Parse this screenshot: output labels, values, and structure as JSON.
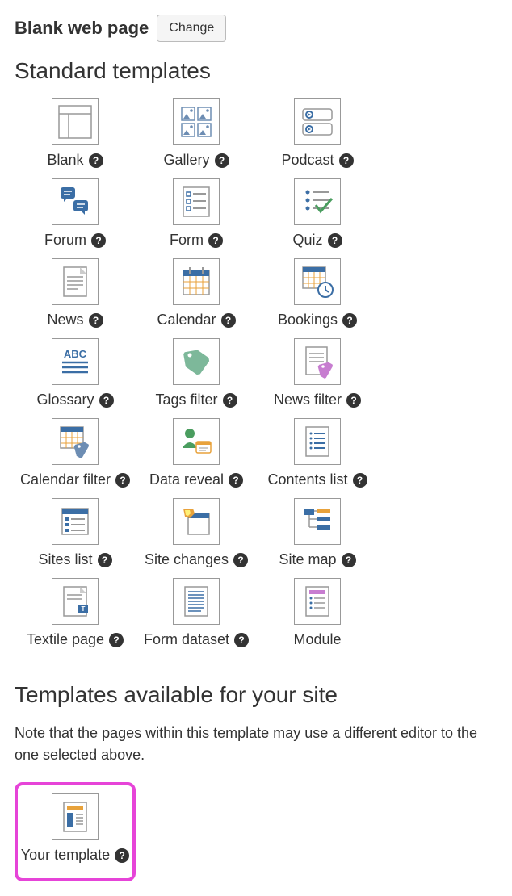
{
  "header": {
    "title": "Blank web page",
    "change_label": "Change"
  },
  "section1": {
    "heading": "Standard templates",
    "templates": [
      {
        "label": "Blank",
        "icon": "blank",
        "help": true
      },
      {
        "label": "Gallery",
        "icon": "gallery",
        "help": true
      },
      {
        "label": "Podcast",
        "icon": "podcast",
        "help": true
      },
      {
        "label": "Forum",
        "icon": "forum",
        "help": true
      },
      {
        "label": "Form",
        "icon": "form",
        "help": true
      },
      {
        "label": "Quiz",
        "icon": "quiz",
        "help": true
      },
      {
        "label": "News",
        "icon": "news",
        "help": true
      },
      {
        "label": "Calendar",
        "icon": "calendar",
        "help": true
      },
      {
        "label": "Bookings",
        "icon": "bookings",
        "help": true
      },
      {
        "label": "Glossary",
        "icon": "glossary",
        "help": true
      },
      {
        "label": "Tags filter",
        "icon": "tags",
        "help": true
      },
      {
        "label": "News filter",
        "icon": "newsfilter",
        "help": true
      },
      {
        "label": "Calendar filter",
        "icon": "calfilter",
        "help": true
      },
      {
        "label": "Data reveal",
        "icon": "datareveal",
        "help": true
      },
      {
        "label": "Contents list",
        "icon": "contents",
        "help": true
      },
      {
        "label": "Sites list",
        "icon": "siteslist",
        "help": true
      },
      {
        "label": "Site changes",
        "icon": "sitechanges",
        "help": true
      },
      {
        "label": "Site map",
        "icon": "sitemap",
        "help": true
      },
      {
        "label": "Textile page",
        "icon": "textile",
        "help": true
      },
      {
        "label": "Form dataset",
        "icon": "formdataset",
        "help": true
      },
      {
        "label": "Module",
        "icon": "module",
        "help": false
      }
    ]
  },
  "section2": {
    "heading": "Templates available for your site",
    "note": "Note that the pages within this template may use a different editor to the one selected above.",
    "templates": [
      {
        "label": "Your template",
        "icon": "yourtemplate",
        "help": true
      }
    ]
  }
}
